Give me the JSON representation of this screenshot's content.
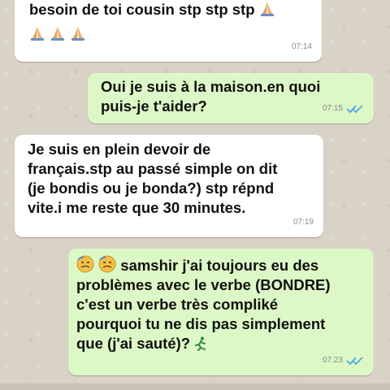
{
  "messages": [
    {
      "id": "m1",
      "direction": "incoming",
      "line1": "besoin de toi cousin stp stp stp",
      "time": "07:14"
    },
    {
      "id": "m2",
      "direction": "outgoing",
      "lines": [
        "Oui je suis à la maison.en quoi",
        "puis-je t'aider?"
      ],
      "time": "07:15",
      "status": "read"
    },
    {
      "id": "m3",
      "direction": "incoming",
      "lines": [
        "Je suis en plein devoir de",
        "français.stp au passé simple on dit",
        "(je bondis ou je bonda?) stp répnd",
        "vite.i me reste que 30 minutes."
      ],
      "time": "07:19"
    },
    {
      "id": "m4",
      "direction": "outgoing",
      "line1": "samshir j'ai toujours eu des",
      "lines": [
        "problèmes avec le verbe (BONDRE)",
        "c'est un verbe très compliké",
        "pourquoi tu ne dis pas simplement"
      ],
      "last_line": "que (j'ai sauté)?",
      "time": "07:23",
      "status": "read"
    }
  ],
  "icons": {
    "pray": "folded-hands-emoji",
    "face": "face-emoji",
    "runner": "running-person-emoji",
    "ticks": "double-check-icon"
  },
  "colors": {
    "incoming_bubble": "#ffffff",
    "outgoing_bubble": "#dcf8c6",
    "read_ticks": "#4fa9e0",
    "background": "#d9d3c7"
  }
}
